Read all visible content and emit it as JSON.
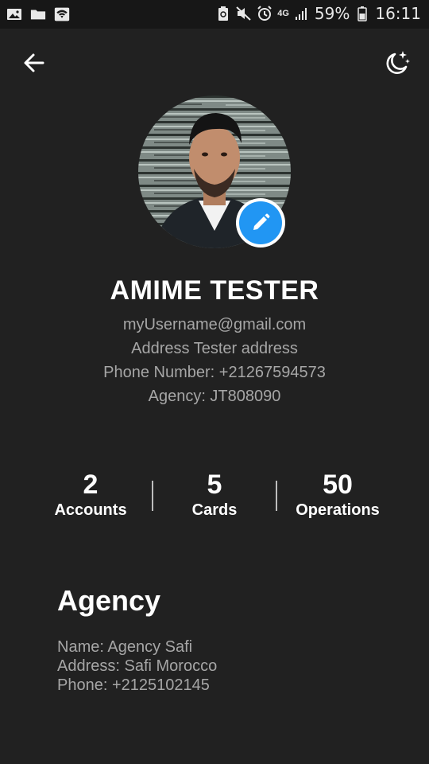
{
  "status_bar": {
    "network": "4G",
    "battery": "59%",
    "time": "16:11",
    "icons": [
      "image-icon",
      "folder-icon",
      "wifi-icon",
      "recycle-icon",
      "mute-icon",
      "alarm-icon",
      "signal-icon",
      "battery-icon"
    ]
  },
  "header": {
    "back_icon": "arrow-left-icon",
    "theme_icon": "moon-stars-icon"
  },
  "profile": {
    "name": "AMIME TESTER",
    "email": "myUsername@gmail.com",
    "address": "Address Tester address",
    "phone": "Phone Number: +21267594573",
    "agency": "Agency: JT808090",
    "edit_icon": "pencil-icon"
  },
  "stats": [
    {
      "value": "2",
      "label": "Accounts"
    },
    {
      "value": "5",
      "label": "Cards"
    },
    {
      "value": "50",
      "label": "Operations"
    }
  ],
  "agency": {
    "title": "Agency",
    "name": "Name: Agency Safi",
    "address": "Address: Safi Morocco",
    "phone": "Phone: +2125102145"
  },
  "colors": {
    "background": "#212121",
    "status_bar": "#171717",
    "accent": "#2196f3",
    "muted_text": "#a6a6a6"
  }
}
